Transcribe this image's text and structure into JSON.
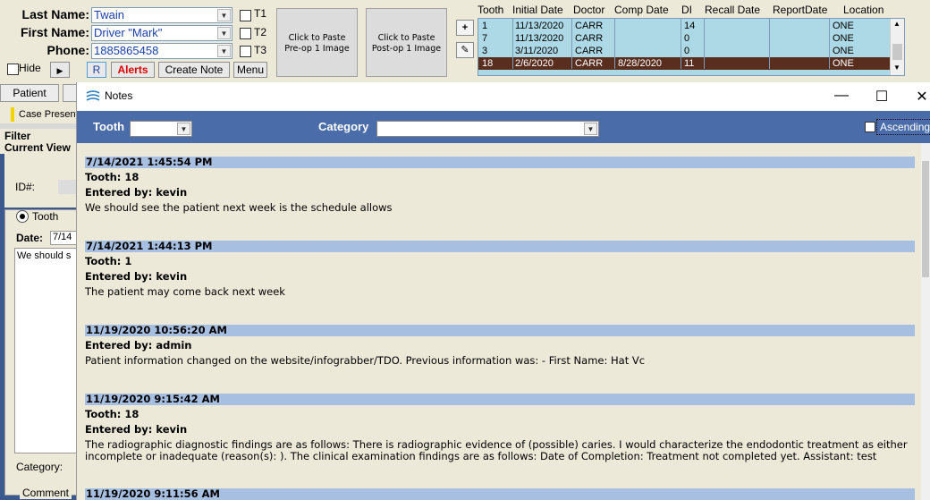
{
  "patient": {
    "last_name_label": "Last Name:",
    "last_name": "Twain",
    "first_name_label": "First Name:",
    "first_name": "Driver \"Mark\"",
    "phone_label": "Phone:",
    "phone": "1885865458",
    "t1": "T1",
    "t2": "T2",
    "t3": "T3",
    "hide": "Hide",
    "r_btn": "R",
    "alerts_btn": "Alerts",
    "create_note_btn": "Create Note",
    "menu_btn": "Menu"
  },
  "paste": {
    "preop_line1": "Click to Paste",
    "preop_line2": "Pre-op 1 Image",
    "postop_line1": "Click to Paste",
    "postop_line2": "Post-op 1 Image"
  },
  "teeth_table": {
    "columns": [
      "Tooth",
      "Initial Date",
      "Doctor",
      "Comp Date",
      "DI",
      "Recall Date",
      "ReportDate",
      "Location"
    ],
    "rows": [
      {
        "tooth": "1",
        "initial": "11/13/2020",
        "doctor": "CARR",
        "comp": "",
        "di": "14",
        "recall": "",
        "report": "",
        "location": "ONE"
      },
      {
        "tooth": "7",
        "initial": "11/13/2020",
        "doctor": "CARR",
        "comp": "",
        "di": "0",
        "recall": "",
        "report": "",
        "location": "ONE"
      },
      {
        "tooth": "3",
        "initial": "3/11/2020",
        "doctor": "CARR",
        "comp": "",
        "di": "0",
        "recall": "",
        "report": "",
        "location": "ONE"
      },
      {
        "tooth": "18",
        "initial": "2/6/2020",
        "doctor": "CARR",
        "comp": "8/28/2020",
        "di": "11",
        "recall": "",
        "report": "",
        "location": "ONE"
      }
    ]
  },
  "background_panel": {
    "patient_tab": "Patient",
    "case_present": "Case Present",
    "filter": "Filter",
    "current_view": "Current View",
    "id_label": "ID#:",
    "tooth_radio": "Tooth",
    "date_label": "Date:",
    "date_value": "7/14",
    "note_preview": "We should s",
    "category_label": "Category:",
    "comment_label": "Comment"
  },
  "notes_window": {
    "title": "Notes",
    "tooth_filter_label": "Tooth",
    "category_filter_label": "Category",
    "ascending_label": "Ascending",
    "notes": [
      {
        "timestamp": "7/14/2021 1:45:54 PM",
        "tooth": "Tooth: 18",
        "entered_by": "Entered by: kevin",
        "body": "We should see the patient next week is the schedule allows"
      },
      {
        "timestamp": "7/14/2021 1:44:13 PM",
        "tooth": "Tooth: 1",
        "entered_by": "Entered by: kevin",
        "body": "The patient may come back next week"
      },
      {
        "timestamp": "11/19/2020 10:56:20 AM",
        "entered_by": "Entered by: admin",
        "body": "Patient information changed on the website/infograbber/TDO. Previous information was: - First Name: Hat Vc"
      },
      {
        "timestamp": "11/19/2020 9:15:42 AM",
        "tooth": "Tooth: 18",
        "entered_by": "Entered by: kevin",
        "body": "The radiographic diagnostic findings are as follows: There is radiographic evidence of (possible) caries. I would characterize the endodontic treatment as either incomplete or inadequate (reason(s): ). The clinical examination findings are as follows: Date of Completion: Treatment not completed yet. Assistant: test"
      },
      {
        "timestamp": "11/19/2020 9:11:56 AM"
      }
    ]
  },
  "colors": {
    "filter_bar": "#4a6ca8",
    "note_header": "#a7bfe0",
    "teeth_grid": "#add8e6",
    "selected_row": "#5a2e1f",
    "alerts_text": "#e00000"
  }
}
